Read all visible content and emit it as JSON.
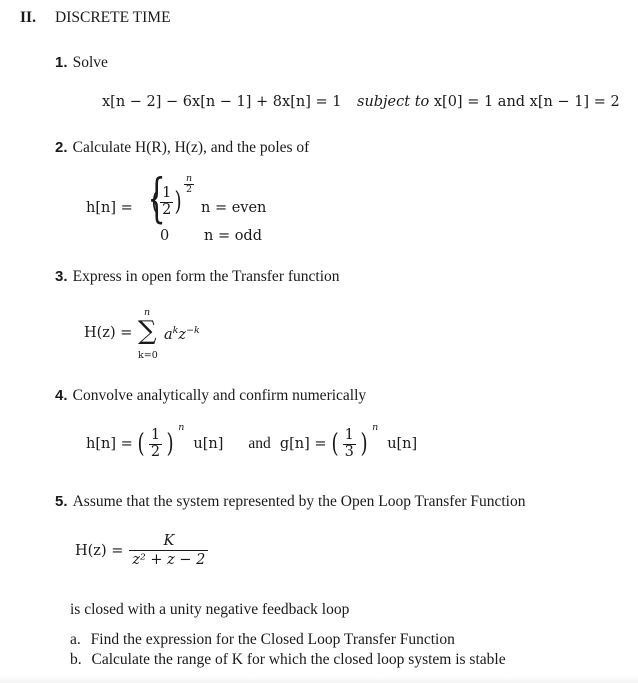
{
  "section": {
    "numeral": "II.",
    "title": "DISCRETE TIME"
  },
  "problems": [
    {
      "number": "1.",
      "instruction": "Solve",
      "equation": "x[n − 2] − 6x[n − 1] + 8x[n] = 1",
      "condition_prefix": "subject to",
      "condition": "x[0] = 1 and x[n − 1] = 2"
    },
    {
      "number": "2.",
      "instruction": "Calculate H(R), H(z), and the poles of",
      "lhs": "h[n] =",
      "case1_base_num": "1",
      "case1_base_den": "2",
      "case1_exp_num": "n",
      "case1_exp_den": "2",
      "case1_condition": "n = even",
      "case2_value": "0",
      "case2_condition": "n = odd"
    },
    {
      "number": "3.",
      "instruction": "Express in open form the Transfer function",
      "lhs": "H(z) =",
      "sum_upper": "n",
      "sum_lower": "k=0",
      "sum_symbol": "∑",
      "term_base1": "a",
      "term_exp1": "k",
      "term_base2": "z",
      "term_exp2": "−k"
    },
    {
      "number": "4.",
      "instruction": "Convolve analytically and confirm numerically",
      "h_lhs": "h[n] =",
      "h_num": "1",
      "h_den": "2",
      "h_exp": "n",
      "h_tail": "u[n]",
      "connector": "and",
      "g_lhs": "g[n] =",
      "g_num": "1",
      "g_den": "3",
      "g_exp": "n",
      "g_tail": "u[n]"
    },
    {
      "number": "5.",
      "instruction": "Assume that the system represented by the Open Loop Transfer Function",
      "lhs": "H(z) =",
      "numerator": "K",
      "denominator": "z² + z − 2",
      "followup": "is closed with a unity negative feedback loop",
      "subitems": [
        {
          "label": "a.",
          "text": "Find the expression for the Closed Loop Transfer Function"
        },
        {
          "label": "b.",
          "text": "Calculate the range of K for which the closed loop system is stable"
        }
      ]
    }
  ]
}
